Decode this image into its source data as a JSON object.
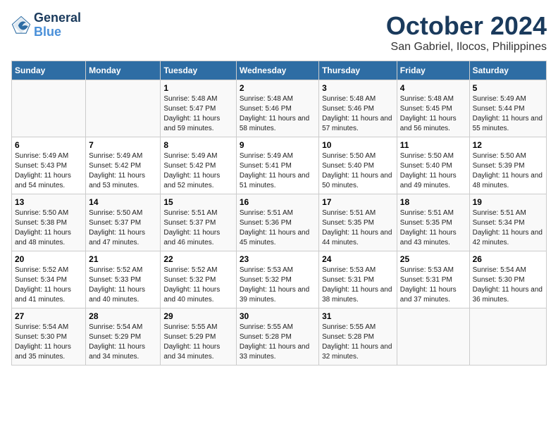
{
  "header": {
    "logo_line1": "General",
    "logo_line2": "Blue",
    "title": "October 2024",
    "subtitle": "San Gabriel, Ilocos, Philippines"
  },
  "columns": [
    "Sunday",
    "Monday",
    "Tuesday",
    "Wednesday",
    "Thursday",
    "Friday",
    "Saturday"
  ],
  "weeks": [
    [
      {
        "day": "",
        "info": ""
      },
      {
        "day": "",
        "info": ""
      },
      {
        "day": "1",
        "info": "Sunrise: 5:48 AM\nSunset: 5:47 PM\nDaylight: 11 hours and 59 minutes."
      },
      {
        "day": "2",
        "info": "Sunrise: 5:48 AM\nSunset: 5:46 PM\nDaylight: 11 hours and 58 minutes."
      },
      {
        "day": "3",
        "info": "Sunrise: 5:48 AM\nSunset: 5:46 PM\nDaylight: 11 hours and 57 minutes."
      },
      {
        "day": "4",
        "info": "Sunrise: 5:48 AM\nSunset: 5:45 PM\nDaylight: 11 hours and 56 minutes."
      },
      {
        "day": "5",
        "info": "Sunrise: 5:49 AM\nSunset: 5:44 PM\nDaylight: 11 hours and 55 minutes."
      }
    ],
    [
      {
        "day": "6",
        "info": "Sunrise: 5:49 AM\nSunset: 5:43 PM\nDaylight: 11 hours and 54 minutes."
      },
      {
        "day": "7",
        "info": "Sunrise: 5:49 AM\nSunset: 5:42 PM\nDaylight: 11 hours and 53 minutes."
      },
      {
        "day": "8",
        "info": "Sunrise: 5:49 AM\nSunset: 5:42 PM\nDaylight: 11 hours and 52 minutes."
      },
      {
        "day": "9",
        "info": "Sunrise: 5:49 AM\nSunset: 5:41 PM\nDaylight: 11 hours and 51 minutes."
      },
      {
        "day": "10",
        "info": "Sunrise: 5:50 AM\nSunset: 5:40 PM\nDaylight: 11 hours and 50 minutes."
      },
      {
        "day": "11",
        "info": "Sunrise: 5:50 AM\nSunset: 5:40 PM\nDaylight: 11 hours and 49 minutes."
      },
      {
        "day": "12",
        "info": "Sunrise: 5:50 AM\nSunset: 5:39 PM\nDaylight: 11 hours and 48 minutes."
      }
    ],
    [
      {
        "day": "13",
        "info": "Sunrise: 5:50 AM\nSunset: 5:38 PM\nDaylight: 11 hours and 48 minutes."
      },
      {
        "day": "14",
        "info": "Sunrise: 5:50 AM\nSunset: 5:37 PM\nDaylight: 11 hours and 47 minutes."
      },
      {
        "day": "15",
        "info": "Sunrise: 5:51 AM\nSunset: 5:37 PM\nDaylight: 11 hours and 46 minutes."
      },
      {
        "day": "16",
        "info": "Sunrise: 5:51 AM\nSunset: 5:36 PM\nDaylight: 11 hours and 45 minutes."
      },
      {
        "day": "17",
        "info": "Sunrise: 5:51 AM\nSunset: 5:35 PM\nDaylight: 11 hours and 44 minutes."
      },
      {
        "day": "18",
        "info": "Sunrise: 5:51 AM\nSunset: 5:35 PM\nDaylight: 11 hours and 43 minutes."
      },
      {
        "day": "19",
        "info": "Sunrise: 5:51 AM\nSunset: 5:34 PM\nDaylight: 11 hours and 42 minutes."
      }
    ],
    [
      {
        "day": "20",
        "info": "Sunrise: 5:52 AM\nSunset: 5:34 PM\nDaylight: 11 hours and 41 minutes."
      },
      {
        "day": "21",
        "info": "Sunrise: 5:52 AM\nSunset: 5:33 PM\nDaylight: 11 hours and 40 minutes."
      },
      {
        "day": "22",
        "info": "Sunrise: 5:52 AM\nSunset: 5:32 PM\nDaylight: 11 hours and 40 minutes."
      },
      {
        "day": "23",
        "info": "Sunrise: 5:53 AM\nSunset: 5:32 PM\nDaylight: 11 hours and 39 minutes."
      },
      {
        "day": "24",
        "info": "Sunrise: 5:53 AM\nSunset: 5:31 PM\nDaylight: 11 hours and 38 minutes."
      },
      {
        "day": "25",
        "info": "Sunrise: 5:53 AM\nSunset: 5:31 PM\nDaylight: 11 hours and 37 minutes."
      },
      {
        "day": "26",
        "info": "Sunrise: 5:54 AM\nSunset: 5:30 PM\nDaylight: 11 hours and 36 minutes."
      }
    ],
    [
      {
        "day": "27",
        "info": "Sunrise: 5:54 AM\nSunset: 5:30 PM\nDaylight: 11 hours and 35 minutes."
      },
      {
        "day": "28",
        "info": "Sunrise: 5:54 AM\nSunset: 5:29 PM\nDaylight: 11 hours and 34 minutes."
      },
      {
        "day": "29",
        "info": "Sunrise: 5:55 AM\nSunset: 5:29 PM\nDaylight: 11 hours and 34 minutes."
      },
      {
        "day": "30",
        "info": "Sunrise: 5:55 AM\nSunset: 5:28 PM\nDaylight: 11 hours and 33 minutes."
      },
      {
        "day": "31",
        "info": "Sunrise: 5:55 AM\nSunset: 5:28 PM\nDaylight: 11 hours and 32 minutes."
      },
      {
        "day": "",
        "info": ""
      },
      {
        "day": "",
        "info": ""
      }
    ]
  ]
}
